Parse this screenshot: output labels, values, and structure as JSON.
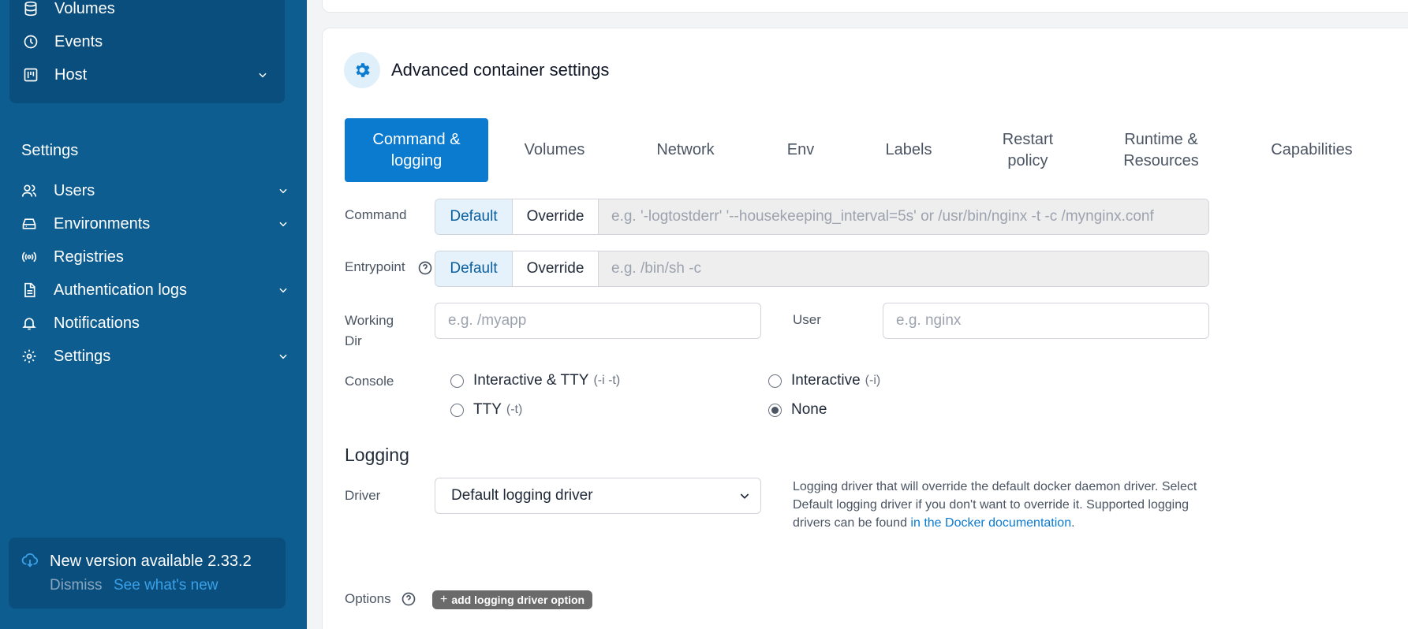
{
  "sidebar": {
    "group_items": [
      {
        "label": "Volumes",
        "icon": "database-icon"
      },
      {
        "label": "Events",
        "icon": "clock-icon"
      },
      {
        "label": "Host",
        "icon": "board-icon"
      }
    ],
    "settings_title": "Settings",
    "settings_items": [
      {
        "label": "Users",
        "icon": "users-icon"
      },
      {
        "label": "Environments",
        "icon": "hard-drive-icon"
      },
      {
        "label": "Registries",
        "icon": "radio-icon"
      },
      {
        "label": "Authentication logs",
        "icon": "file-icon"
      },
      {
        "label": "Notifications",
        "icon": "bell-icon"
      },
      {
        "label": "Settings",
        "icon": "gear-icon"
      }
    ],
    "update": {
      "title": "New version available 2.33.2",
      "dismiss": "Dismiss",
      "whats_new": "See what's new"
    }
  },
  "card": {
    "title": "Advanced container settings",
    "tabs": [
      {
        "label": "Command & logging"
      },
      {
        "label": "Volumes"
      },
      {
        "label": "Network"
      },
      {
        "label": "Env"
      },
      {
        "label": "Labels"
      },
      {
        "label": "Restart policy"
      },
      {
        "label": "Runtime & Resources"
      },
      {
        "label": "Capabilities"
      }
    ]
  },
  "form": {
    "command": {
      "label": "Command",
      "default": "Default",
      "override": "Override",
      "placeholder": "e.g. '-logtostderr' '--housekeeping_interval=5s' or /usr/bin/nginx -t -c /mynginx.conf"
    },
    "entrypoint": {
      "label": "Entrypoint",
      "default": "Default",
      "override": "Override",
      "placeholder": "e.g. /bin/sh -c"
    },
    "working_dir": {
      "label": "Working Dir",
      "placeholder": "e.g. /myapp"
    },
    "user": {
      "label": "User",
      "placeholder": "e.g. nginx"
    },
    "console": {
      "label": "Console",
      "options": [
        {
          "label": "Interactive & TTY",
          "hint": "(-i -t)"
        },
        {
          "label": "Interactive",
          "hint": "(-i)"
        },
        {
          "label": "TTY",
          "hint": "(-t)"
        },
        {
          "label": "None",
          "hint": ""
        }
      ],
      "selected": "None"
    }
  },
  "logging": {
    "title": "Logging",
    "driver_label": "Driver",
    "driver_value": "Default logging driver",
    "desc_part1": "Logging driver that will override the default docker daemon driver. Select Default logging driver if you don't want to override it. Supported logging drivers can be found ",
    "desc_link": "in the Docker documentation",
    "desc_end": ".",
    "options_label": "Options",
    "add_option": "add logging driver option"
  },
  "colors": {
    "sidebar": "#0d5d91",
    "accent": "#0b7bd0"
  }
}
